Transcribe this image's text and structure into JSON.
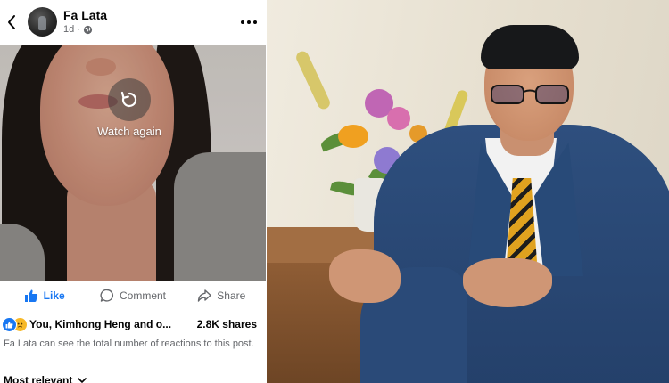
{
  "post": {
    "back_icon": "chevron-left-icon",
    "author": "Fa Lata",
    "age": "1d",
    "separator": "·",
    "privacy_icon": "globe-icon",
    "more_icon": "more-horizontal-icon"
  },
  "video": {
    "replay_icon": "replay-icon",
    "watch_again": "Watch again"
  },
  "actions": {
    "like": "Like",
    "comment": "Comment",
    "share": "Share"
  },
  "engagement": {
    "reactions_text": "You, Kimhong Heng and o...",
    "shares": "2.8K shares",
    "visibility_note": "Fa Lata can see the total number of reactions to this post."
  },
  "comments": {
    "sort": "Most relevant"
  },
  "colors": {
    "brand_blue": "#1877f2",
    "text_primary": "#050505",
    "text_secondary": "#65676b"
  }
}
